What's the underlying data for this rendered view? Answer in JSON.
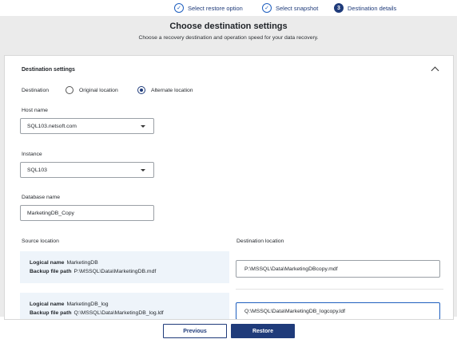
{
  "stepper": {
    "steps": [
      {
        "label": "Select restore option",
        "state": "done"
      },
      {
        "label": "Select snapshot",
        "state": "done"
      },
      {
        "label": "Destination details",
        "number": "3",
        "state": "active"
      }
    ]
  },
  "header": {
    "title": "Choose destination settings",
    "subtitle": "Choose a recovery destination and operation speed for your data recovery."
  },
  "panel": {
    "title": "Destination settings",
    "destination_label": "Destination",
    "options": [
      {
        "label": "Original location",
        "selected": false
      },
      {
        "label": "Alternate location",
        "selected": true
      }
    ],
    "host": {
      "label": "Host name",
      "value": "SQL103.netsoft.com"
    },
    "instance": {
      "label": "Instance",
      "value": "SQL103"
    },
    "database": {
      "label": "Database name",
      "value": "MarketingDB_Copy"
    },
    "source_header": "Source location",
    "dest_header": "Destination location",
    "files": [
      {
        "logical_label": "Logical name",
        "logical_value": "MarketingDB",
        "path_label": "Backup file path",
        "path_value": "P:\\MSSQL\\Data\\MarketingDB.mdf",
        "destination": "P:\\MSSQL\\Data\\MarketingDBcopy.mdf"
      },
      {
        "logical_label": "Logical name",
        "logical_value": "MarketingDB_log",
        "path_label": "Backup file path",
        "path_value": "Q:\\MSSQL\\Data\\MarketingDB_log.ldf",
        "destination": "Q:\\MSSQL\\Data\\MarketingDB_logcopy.ldf"
      }
    ]
  },
  "footer": {
    "previous": "Previous",
    "restore": "Restore"
  },
  "colors": {
    "accent": "#1f3b7a",
    "highlight": "#eef4fa",
    "header_bg": "#ebebeb"
  }
}
